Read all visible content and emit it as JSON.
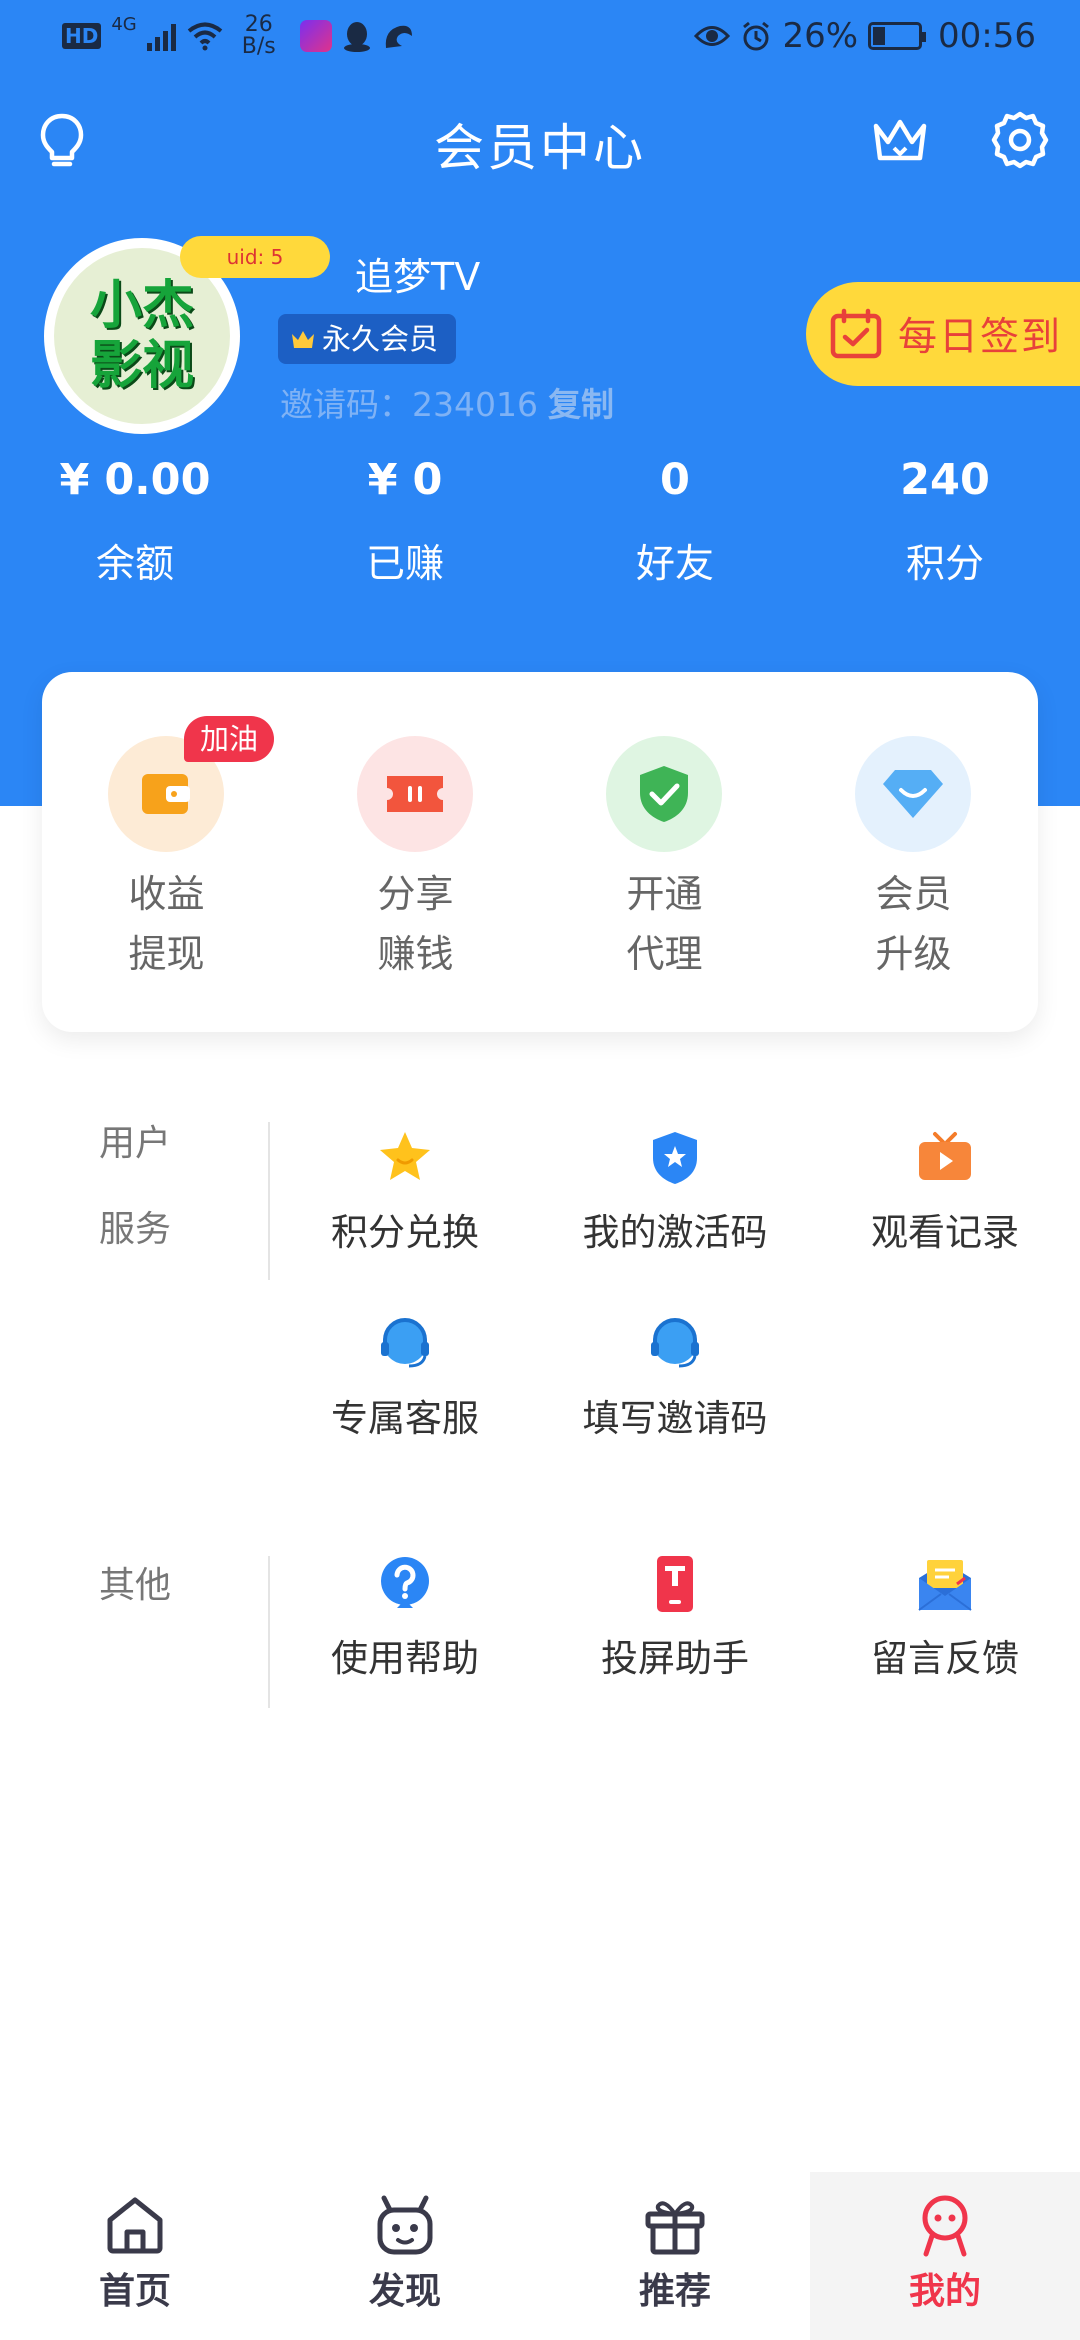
{
  "status_bar": {
    "hd": "HD",
    "network": "4G",
    "speed_top": "26",
    "speed_bottom": "B/s",
    "battery_pct": "26%",
    "battery_level": 0.26,
    "time": "00:56"
  },
  "nav": {
    "title": "会员中心",
    "left_icon": "lightbulb-icon",
    "right_icons": [
      "crown-icon",
      "settings-icon"
    ]
  },
  "profile": {
    "avatar_text_line1": "小杰",
    "avatar_text_line2": "影视",
    "uid": "uid: 5",
    "username": "追梦TV",
    "vip_label": "永久会员",
    "invite_label": "邀请码：234016",
    "invite_copy": "复制",
    "signin_label": "每日签到"
  },
  "stats": [
    {
      "value": "¥ 0.00",
      "label": "余额"
    },
    {
      "value": "¥ 0",
      "label": "已赚"
    },
    {
      "value": "0",
      "label": "好友"
    },
    {
      "value": "240",
      "label": "积分"
    }
  ],
  "card": {
    "badge": "加油",
    "items": [
      {
        "line1": "收益",
        "line2": "提现",
        "icon": "wallet-icon",
        "bg": "#fdebd6"
      },
      {
        "line1": "分享",
        "line2": "赚钱",
        "icon": "ticket-icon",
        "bg": "#fde4e4"
      },
      {
        "line1": "开通",
        "line2": "代理",
        "icon": "shield-check-icon",
        "bg": "#dff5e2"
      },
      {
        "line1": "会员",
        "line2": "升级",
        "icon": "diamond-icon",
        "bg": "#e4f1fd"
      }
    ]
  },
  "user_services": {
    "title_line1": "用户",
    "title_line2": "服务",
    "items": [
      {
        "label": "积分兑换",
        "icon": "star-icon"
      },
      {
        "label": "我的激活码",
        "icon": "badge-star-icon"
      },
      {
        "label": "观看记录",
        "icon": "tv-play-icon"
      },
      {
        "label": "专属客服",
        "icon": "headset-icon"
      },
      {
        "label": "填写邀请码",
        "icon": "headset-icon"
      }
    ]
  },
  "others": {
    "title": "其他",
    "items": [
      {
        "label": "使用帮助",
        "icon": "help-icon"
      },
      {
        "label": "投屏助手",
        "icon": "cast-device-icon"
      },
      {
        "label": "留言反馈",
        "icon": "mail-feedback-icon"
      }
    ]
  },
  "tabbar": {
    "items": [
      {
        "label": "首页",
        "icon": "home-icon",
        "active": false
      },
      {
        "label": "发现",
        "icon": "discover-robot-icon",
        "active": false
      },
      {
        "label": "推荐",
        "icon": "gift-icon",
        "active": false
      },
      {
        "label": "我的",
        "icon": "profile-face-icon",
        "active": true
      }
    ]
  },
  "colors": {
    "primary": "#2b86f5",
    "accent_yellow": "#ffd93b",
    "accent_red": "#f0354b"
  }
}
